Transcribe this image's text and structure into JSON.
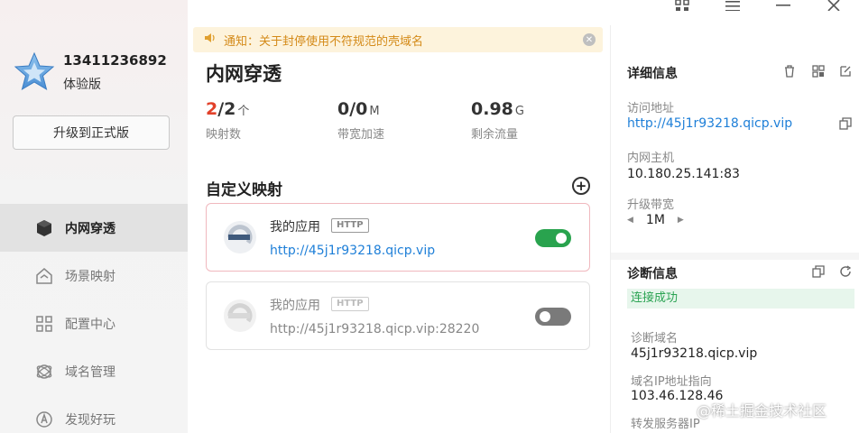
{
  "sidebar": {
    "phone": "13411236892",
    "plan": "体验版",
    "upgrade_label": "升级到正式版",
    "items": [
      {
        "label": "内网穿透",
        "icon": "cube-icon"
      },
      {
        "label": "场景映射",
        "icon": "home-icon"
      },
      {
        "label": "配置中心",
        "icon": "grid-icon"
      },
      {
        "label": "域名管理",
        "icon": "globe-icon"
      },
      {
        "label": "发现好玩",
        "icon": "compass-icon"
      }
    ]
  },
  "notice": {
    "text": "通知：关于封停使用不符规范的壳域名"
  },
  "main": {
    "title": "内网穿透",
    "stats": {
      "mappings": {
        "used": "2",
        "total": "/2",
        "unit": "个",
        "label": "映射数"
      },
      "bandwidth": {
        "value": "0/0",
        "unit": "M",
        "label": "带宽加速"
      },
      "traffic": {
        "value": "0.98",
        "unit": "G",
        "label": "剩余流量"
      }
    },
    "section_title": "自定义映射",
    "cards": [
      {
        "name": "我的应用",
        "protocol": "HTTP",
        "url": "http://45j1r93218.qicp.vip",
        "enabled": true
      },
      {
        "name": "我的应用",
        "protocol": "HTTP",
        "url": "http://45j1r93218.qicp.vip:28220",
        "enabled": false
      }
    ]
  },
  "details": {
    "title": "详细信息",
    "access_label": "访问地址",
    "access_url": "http://45j1r93218.qicp.vip",
    "host_label": "内网主机",
    "host_value": "10.180.25.141:83",
    "bandwidth_label": "升级带宽",
    "bandwidth_value": "1M"
  },
  "diagnosis": {
    "title": "诊断信息",
    "status": "连接成功",
    "domain_label": "诊断域名",
    "domain_value": "45j1r93218.qicp.vip",
    "ip_label": "域名IP地址指向",
    "ip_value": "103.46.128.46",
    "server_label": "转发服务器IP"
  },
  "watermark": "@稀土掘金技术社区",
  "colors": {
    "accent_red": "#e2412a",
    "link_blue": "#1e7fd8",
    "toggle_on": "#29a34e",
    "success_bg": "#e7f6ec",
    "notice_bg": "#fdf3dc",
    "notice_text": "#d48a18"
  }
}
